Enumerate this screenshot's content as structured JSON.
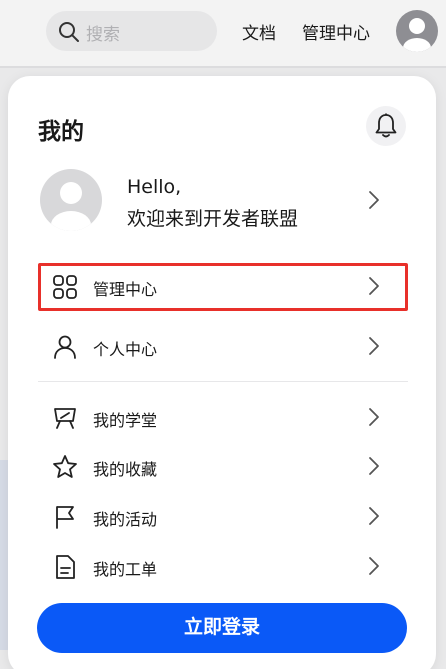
{
  "header": {
    "search_placeholder": "搜索",
    "nav_docs": "文档",
    "nav_management": "管理中心"
  },
  "panel": {
    "title": "我的",
    "greeting_line1": "Hello,",
    "greeting_line2": "欢迎来到开发者联盟",
    "menu": [
      {
        "label": "管理中心",
        "icon": "grid-icon"
      },
      {
        "label": "个人中心",
        "icon": "person-icon"
      },
      {
        "label": "我的学堂",
        "icon": "presentation-icon"
      },
      {
        "label": "我的收藏",
        "icon": "star-icon"
      },
      {
        "label": "我的活动",
        "icon": "flag-icon"
      },
      {
        "label": "我的工单",
        "icon": "document-icon"
      }
    ],
    "login_label": "立即登录"
  },
  "colors": {
    "accent": "#0a59f7",
    "highlight_border": "#e8302a"
  }
}
